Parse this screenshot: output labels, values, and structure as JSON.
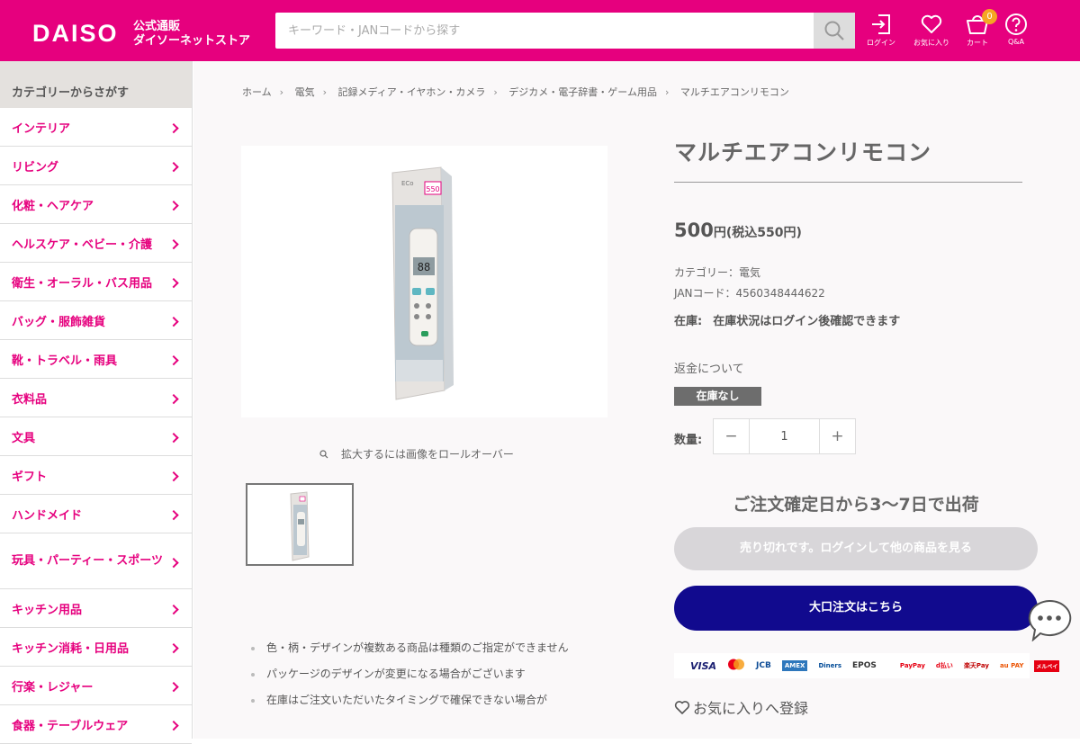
{
  "header": {
    "logo": "DAISO",
    "logo_sub_1": "公式通販",
    "logo_sub_2": "ダイソーネットストア",
    "search_placeholder": "キーワード・JANコードから探す",
    "icons": [
      {
        "label": "ログイン",
        "icon": "login-icon"
      },
      {
        "label": "お気に入り",
        "icon": "heart-icon"
      },
      {
        "label": "カート",
        "icon": "cart-icon",
        "badge": "0"
      },
      {
        "label": "Q&A",
        "icon": "question-icon"
      }
    ],
    "color": "#e6007e"
  },
  "sidebar": {
    "heading": "カテゴリーからさがす",
    "items": [
      "インテリア",
      "リビング",
      "化粧・ヘアケア",
      "ヘルスケア・ベビー・介護",
      "衛生・オーラル・バス用品",
      "バッグ・服飾雑貨",
      "靴・トラベル・雨具",
      "衣料品",
      "文具",
      "ギフト",
      "ハンドメイド",
      "玩具・パーティー・スポーツ",
      "キッチン用品",
      "キッチン消耗・日用品",
      "行楽・レジャー",
      "食器・テーブルウェア"
    ]
  },
  "breadcrumb": [
    "ホーム",
    "電気",
    "記録メディア・イヤホン・カメラ",
    "デジカメ・電子辞書・ゲーム用品",
    "マルチエアコンリモコン"
  ],
  "gallery": {
    "zoom_note": "拡大するには画像をロールオーバー",
    "package_price_tag": "550",
    "package_brand": "ECo",
    "display_digits": "88"
  },
  "notes": [
    "色・柄・デザインが複数ある商品は種類のご指定ができません",
    "パッケージのデザインが変更になる場合がございます",
    "在庫はご注文いただいたタイミングで確保できない場合が"
  ],
  "product": {
    "title": "マルチエアコンリモコン",
    "price": "500",
    "price_unit": "円(税込550円)",
    "category": "カテゴリー：電気",
    "jan": "JANコード：4560348444622",
    "stock_label": "在庫:",
    "stock_text": "在庫状況はログイン後確認できます",
    "refund": "返金について",
    "out_of_stock": "在庫なし",
    "qty_label": "数量:",
    "qty_value": "1",
    "minus": "−",
    "plus": "+",
    "shipping": "ご注文確定日から3〜7日で出荷",
    "sold_out_button": "売り切れです。ログインして他の商品を見る",
    "bulk_button": "大口注文はこちら",
    "favorite": "お気に入りへ登録"
  },
  "payments": [
    "VISA",
    "MC",
    "JCB",
    "AMEX",
    "Diners",
    "EPOS",
    "PayPay",
    "d払い",
    "楽天Pay",
    "au PAY",
    "メルペイ"
  ]
}
